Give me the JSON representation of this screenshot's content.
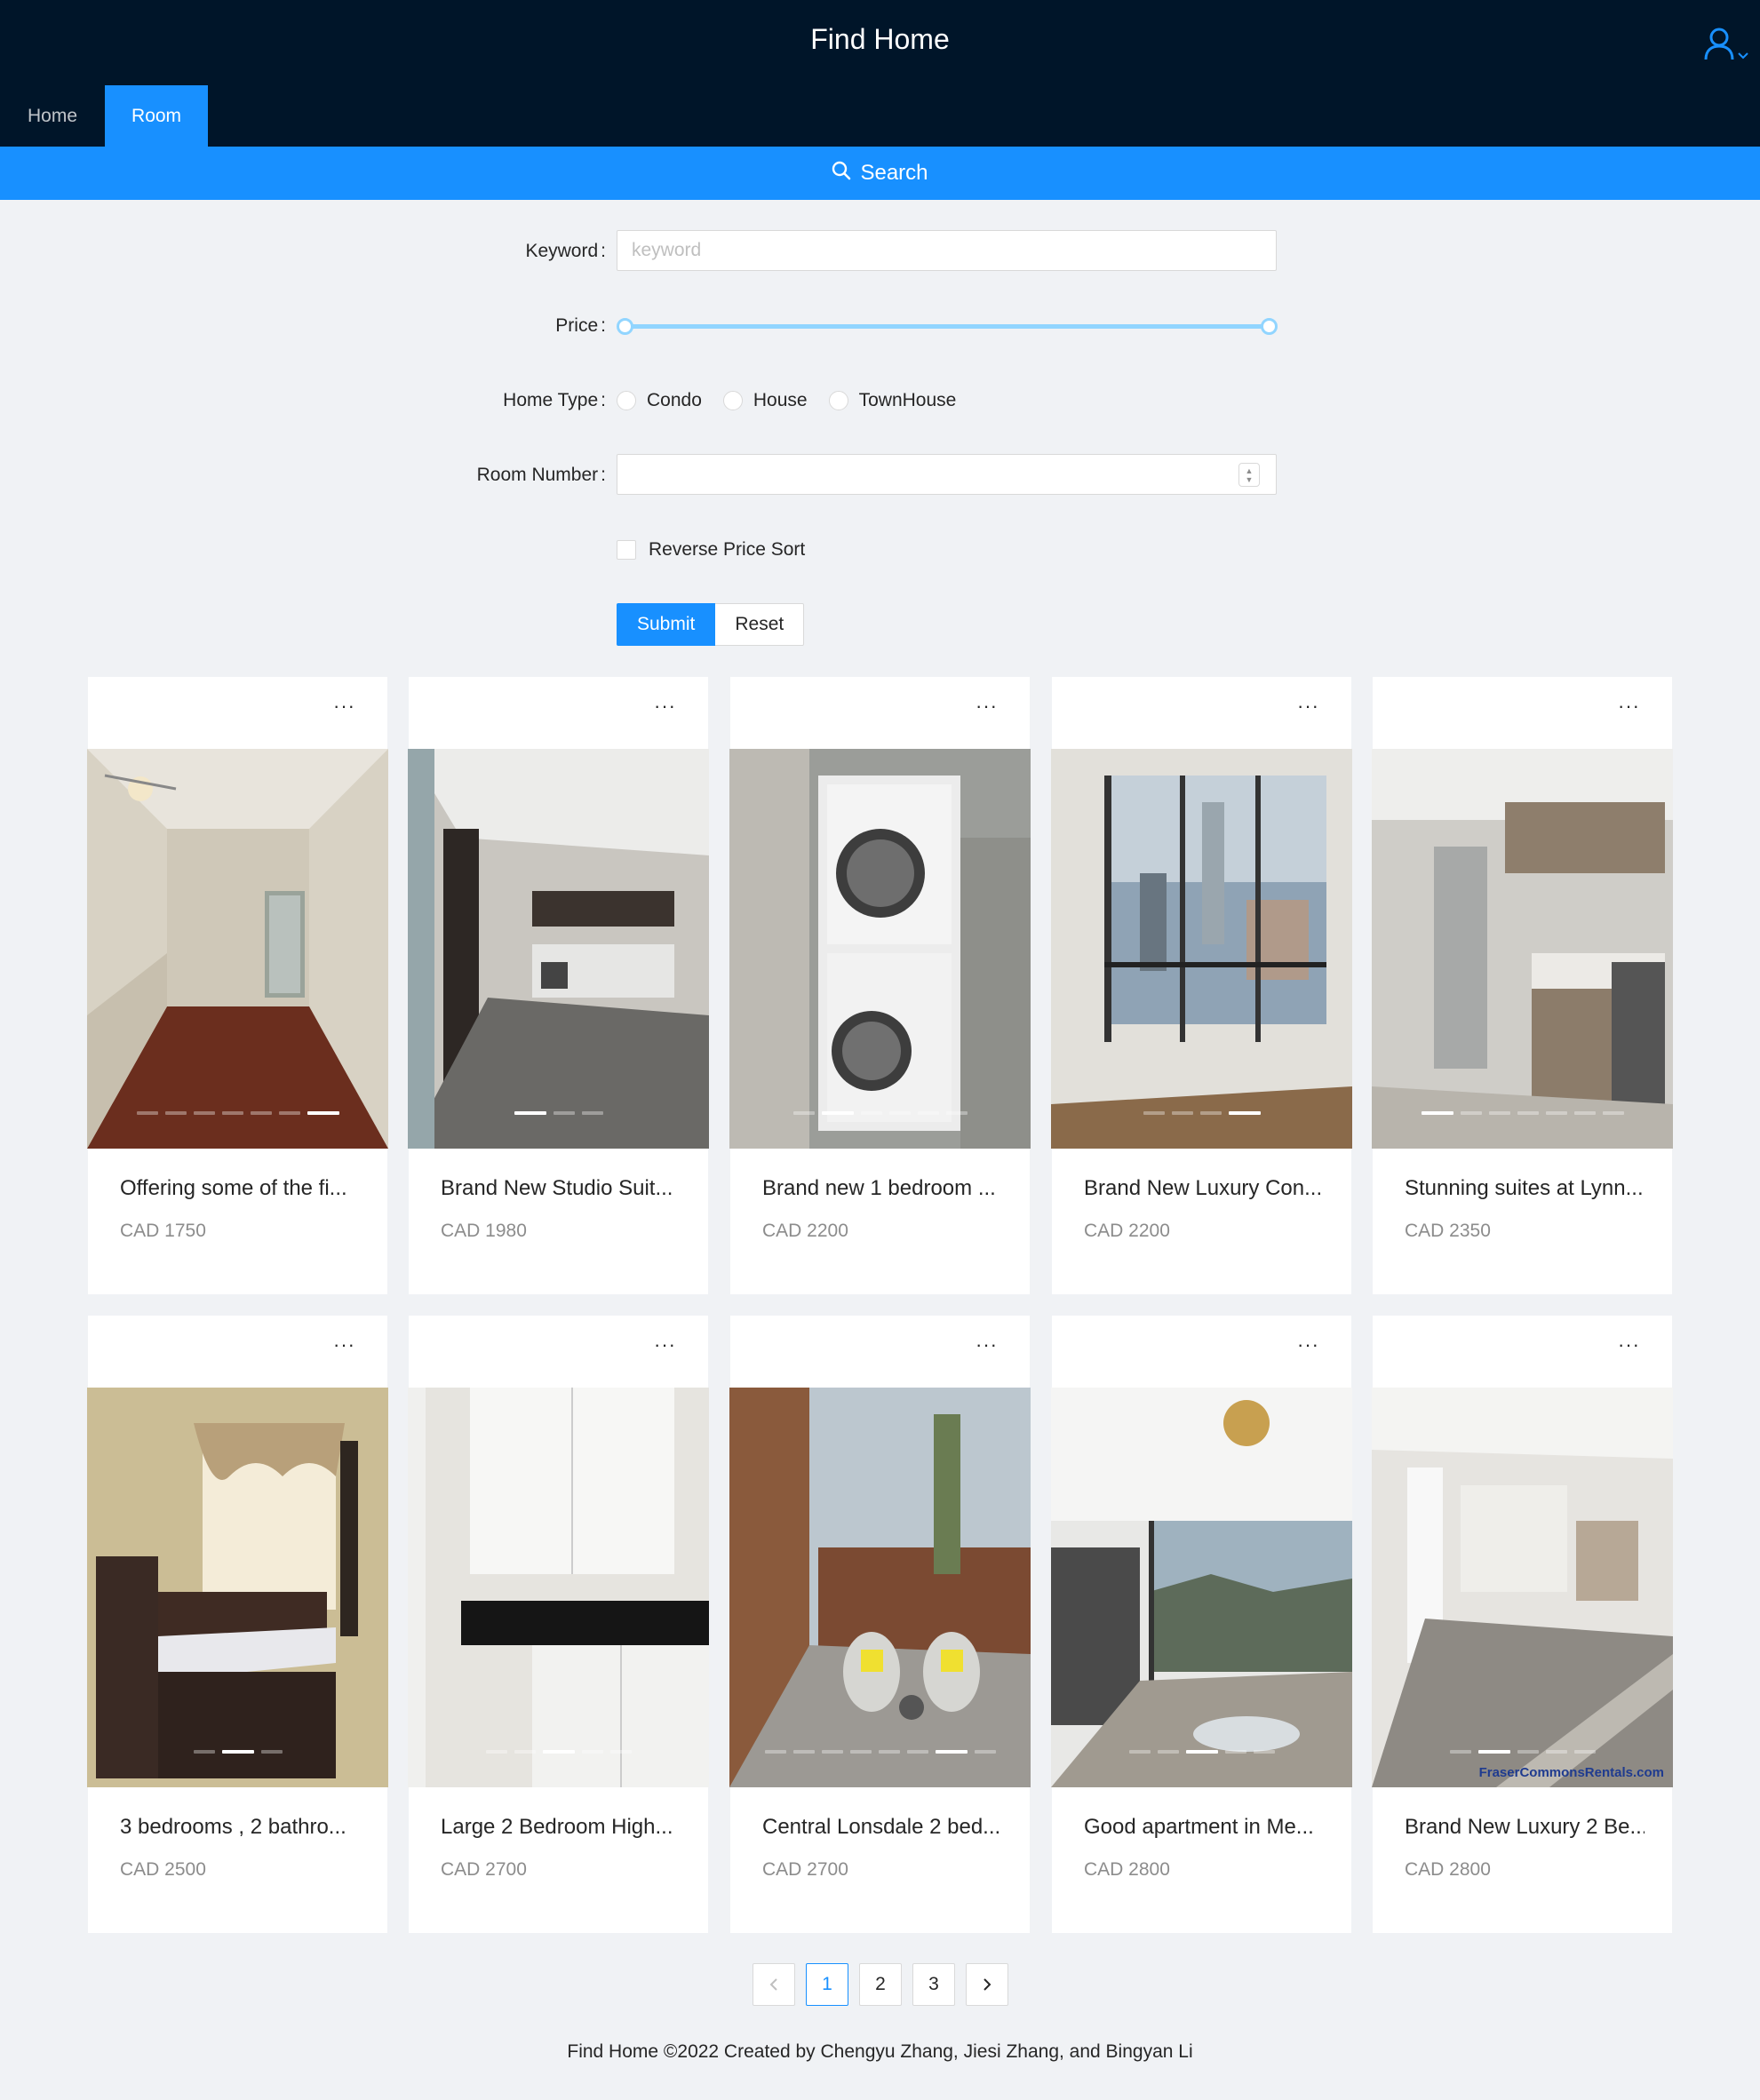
{
  "header": {
    "title": "Find Home",
    "nav": [
      {
        "label": "Home",
        "active": false
      },
      {
        "label": "Room",
        "active": true
      }
    ]
  },
  "search_bar": {
    "label": "Search"
  },
  "form": {
    "keyword": {
      "label": "Keyword",
      "placeholder": "keyword",
      "value": ""
    },
    "price": {
      "label": "Price",
      "range_fraction": [
        0,
        1
      ]
    },
    "home_type": {
      "label": "Home Type",
      "options": [
        "Condo",
        "House",
        "TownHouse"
      ],
      "selected": null
    },
    "room_number": {
      "label": "Room Number",
      "value": ""
    },
    "reverse_sort": {
      "label": "Reverse Price Sort",
      "checked": false
    },
    "submit_label": "Submit",
    "reset_label": "Reset"
  },
  "listings": [
    {
      "title": "Offering some of the fi...",
      "price": "CAD 1750",
      "slides": 7,
      "active_slide": 6,
      "scene": "empty-room"
    },
    {
      "title": "Brand New Studio Suit...",
      "price": "CAD 1980",
      "slides": 3,
      "active_slide": 0,
      "scene": "modern-kitchen"
    },
    {
      "title": "Brand new 1 bedroom ...",
      "price": "CAD 2200",
      "slides": 6,
      "active_slide": 1,
      "scene": "laundry"
    },
    {
      "title": "Brand New Luxury Con...",
      "price": "CAD 2200",
      "slides": 4,
      "active_slide": 3,
      "scene": "city-view"
    },
    {
      "title": "Stunning suites at Lynn...",
      "price": "CAD 2350",
      "slides": 7,
      "active_slide": 0,
      "scene": "kitchen"
    },
    {
      "title": "3 bedrooms , 2 bathro...",
      "price": "CAD 2500",
      "slides": 3,
      "active_slide": 1,
      "scene": "bedroom"
    },
    {
      "title": "Large 2 Bedroom High...",
      "price": "CAD 2700",
      "slides": 5,
      "active_slide": 2,
      "scene": "cabinets"
    },
    {
      "title": "Central Lonsdale 2 bed...",
      "price": "CAD 2700",
      "slides": 8,
      "active_slide": 6,
      "scene": "patio"
    },
    {
      "title": "Good apartment in Me...",
      "price": "CAD 2800",
      "slides": 5,
      "active_slide": 2,
      "scene": "loft"
    },
    {
      "title": "Brand New Luxury 2 Be...",
      "price": "CAD 2800",
      "slides": 5,
      "active_slide": 1,
      "scene": "open-plan",
      "watermark": "FraserCommonsRentals.com"
    }
  ],
  "pagination": {
    "pages": [
      "1",
      "2",
      "3"
    ],
    "current": "1",
    "prev_icon": "left-arrow-icon",
    "next_icon": "right-arrow-icon"
  },
  "footer": {
    "text": "Find Home ©2022 Created by Chengyu Zhang, Jiesi Zhang, and Bingyan Li"
  },
  "colors": {
    "header_bg": "#001529",
    "primary": "#1890ff",
    "page_bg": "#f0f2f5",
    "slider": "#91d5ff"
  }
}
